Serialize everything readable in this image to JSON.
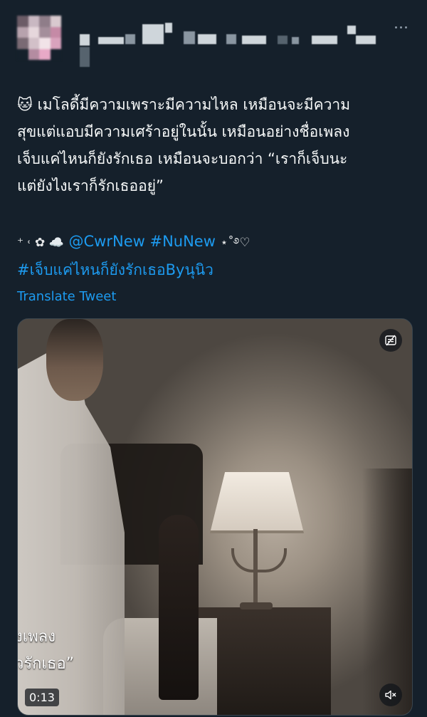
{
  "tweet": {
    "lines": [
      "🐱 เมโลดี้มีความเพราะมีความไหล เหมือนจะมีความ",
      "สุขแต่แอบมีความเศร้าอยู่ในนั้น เหมือนอย่างชื่อเพลง",
      "เจ็บแค่ไหนก็ยังรักเธอ เหมือนจะบอกว่า “เราก็เจ็บนะ",
      "แต่ยังไงเราก็รักเธออยู่”"
    ],
    "deco_prefix": "⁺ ˓ ✿ ☁️",
    "mention": "@CwrNew",
    "hashtag1": "#NuNew",
    "deco_suffix": "⋆˚࿔♡",
    "hashtag2": "#เจ็บแค่ไหนก็ยังรักเธอByนุนิว"
  },
  "translate_label": "Translate Tweet",
  "media": {
    "subtitle_line1": "งเพลง",
    "subtitle_line2": "วรักเธอ”",
    "duration": "0:13"
  },
  "icons": {
    "more": "more-options-icon",
    "media_mode": "no-caption-icon",
    "mute": "muted-volume-icon"
  },
  "colors": {
    "background": "#15202b",
    "link": "#1d9bf0",
    "text": "#f7f9f9"
  }
}
